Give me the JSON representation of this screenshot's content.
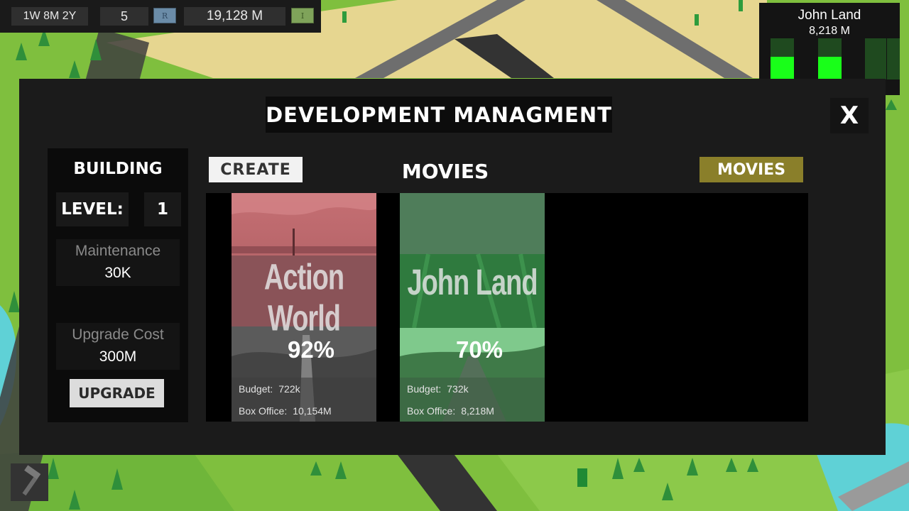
{
  "hud": {
    "date": "1W 8M 2Y",
    "count": "5",
    "count_badge": "R",
    "money": "19,128 M",
    "money_badge": "I"
  },
  "widget": {
    "title": "John Land",
    "value": "8,218 M",
    "bars": [
      0.55,
      0.55,
      0.0,
      0.0
    ]
  },
  "panel": {
    "title": "DEVELOPMENT MANAGMENT",
    "close_label": "X",
    "building": {
      "heading": "BUILDING",
      "level_label": "LEVEL:",
      "level_value": "1",
      "maintenance_label": "Maintenance",
      "maintenance_value": "30K",
      "upgrade_cost_label": "Upgrade Cost",
      "upgrade_cost_value": "300M",
      "upgrade_label": "UPGRADE"
    },
    "create_label": "CREATE",
    "section_title": "MOVIES",
    "movies_button_label": "MOVIES",
    "movies": [
      {
        "title": "Action World",
        "score": "92%",
        "budget_label": "Budget:",
        "budget": "722k",
        "box_office_label": "Box Office:",
        "box_office": "10,154M",
        "tint": "#b96a6e"
      },
      {
        "title": "John Land",
        "score": "70%",
        "budget_label": "Budget:",
        "budget": "732k",
        "box_office_label": "Box Office:",
        "box_office": "8,218M",
        "tint": "#3f8a52"
      }
    ]
  },
  "tools": {
    "hammer_icon": "hammer-icon"
  },
  "colors": {
    "accent_olive": "#8a7f2a",
    "bar_green": "#19ff19",
    "panel_bg": "#1b1b1b"
  }
}
